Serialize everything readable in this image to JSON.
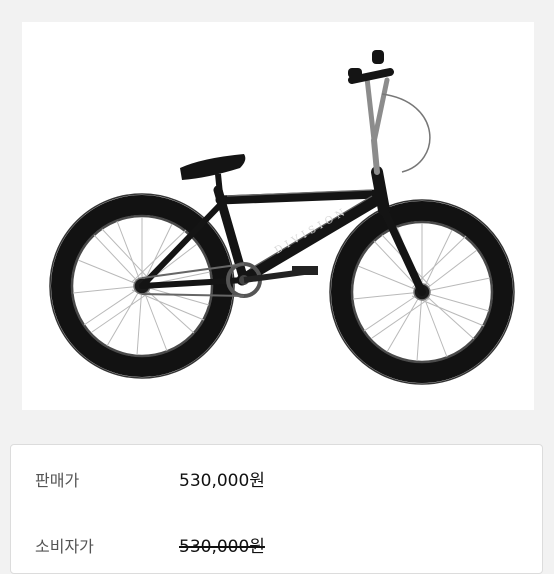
{
  "product": {
    "image_alt": "BMX bicycle",
    "frame_brand": "DIVISION",
    "colors": {
      "page_background": "#f2f2f2",
      "frame": "#141414",
      "tire": "#161616",
      "spoke": "#b9b9b9",
      "chrome": "#8c8c8c"
    }
  },
  "pricing": {
    "sale_label": "판매가",
    "sale_price": "530,000원",
    "retail_label": "소비자가",
    "retail_price": "530,000원"
  }
}
